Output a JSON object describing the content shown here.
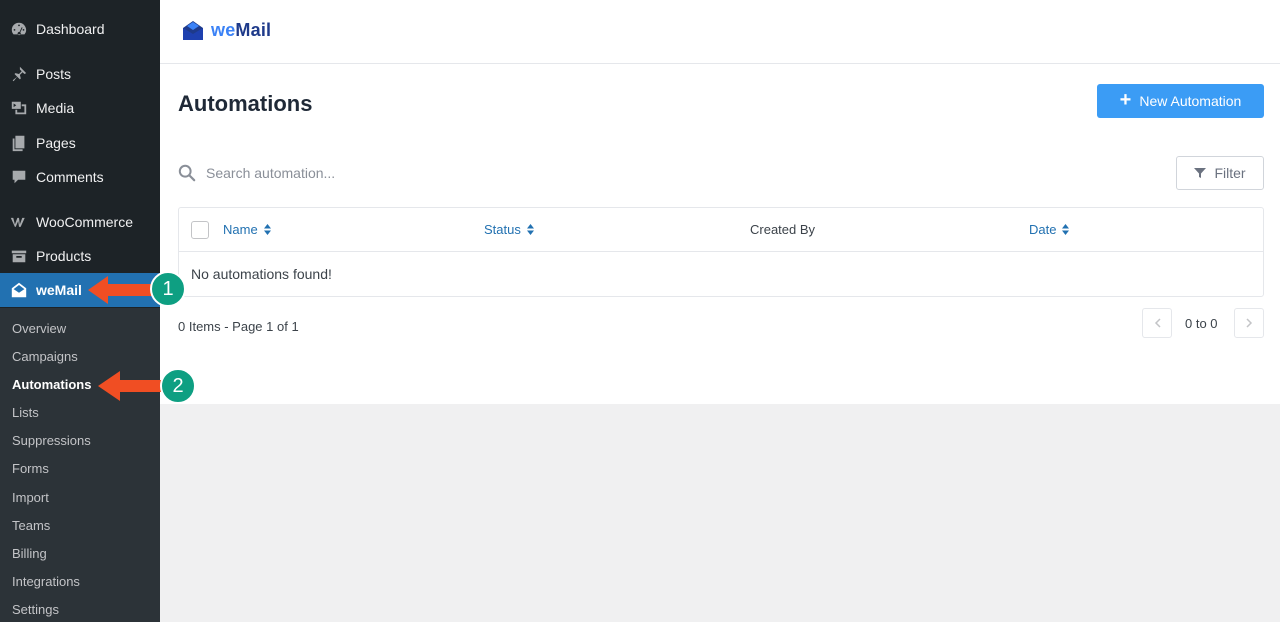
{
  "sidebar": {
    "items": [
      {
        "label": "Dashboard",
        "icon": "dashboard-icon"
      },
      {
        "label": "Posts",
        "icon": "pin-icon"
      },
      {
        "label": "Media",
        "icon": "media-icon"
      },
      {
        "label": "Pages",
        "icon": "pages-icon"
      },
      {
        "label": "Comments",
        "icon": "comment-icon"
      },
      {
        "label": "WooCommerce",
        "icon": "woocommerce-icon"
      },
      {
        "label": "Products",
        "icon": "products-icon"
      },
      {
        "label": "weMail",
        "icon": "wemail-icon"
      }
    ],
    "submenu": [
      "Overview",
      "Campaigns",
      "Automations",
      "Lists",
      "Suppressions",
      "Forms",
      "Import",
      "Teams",
      "Billing",
      "Integrations",
      "Settings"
    ],
    "active_item": "weMail",
    "current_sub": "Automations"
  },
  "header": {
    "logo_prefix": "we",
    "logo_suffix": "Mail"
  },
  "main": {
    "title": "Automations",
    "new_button": "New Automation",
    "search_placeholder": "Search automation...",
    "filter_button": "Filter",
    "columns": [
      "Name",
      "Status",
      "Created By",
      "Date"
    ],
    "empty_message": "No automations found!",
    "page_info": "0 Items - Page 1 of 1",
    "range": "0 to 0"
  },
  "annotations": {
    "badge_1": "1",
    "badge_2": "2"
  },
  "colors": {
    "sidebar_bg": "#1d2327",
    "active_bg": "#2271b1",
    "primary_button": "#3b9cf5",
    "arrow": "#f04e23",
    "badge": "#0e9f82"
  }
}
